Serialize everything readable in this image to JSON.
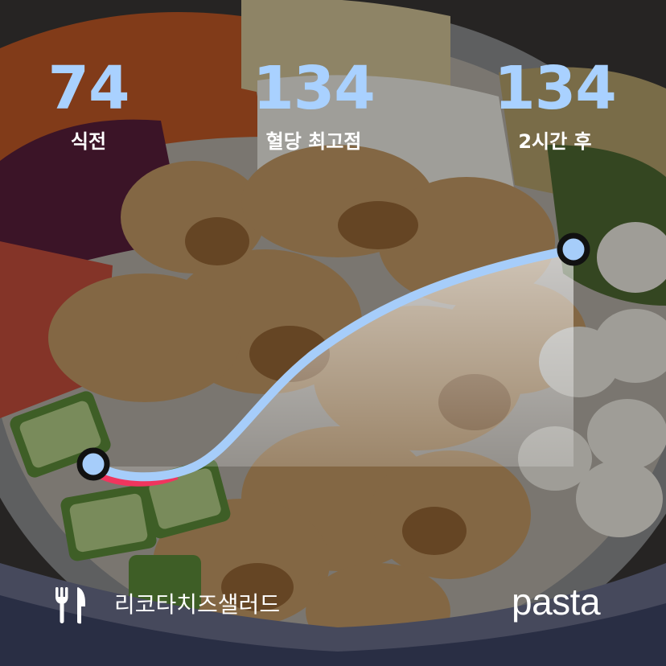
{
  "stats": [
    {
      "value": "74",
      "label": "식전"
    },
    {
      "value": "134",
      "label": "혈당 최고점"
    },
    {
      "value": "134",
      "label": "2시간 후"
    }
  ],
  "meal": {
    "icon": "utensils-icon",
    "name": "리코타치즈샐러드"
  },
  "brand": {
    "name": "pasta"
  },
  "colors": {
    "accent": "#a9d1ff",
    "curve": "#a6cdfa",
    "dip_highlight": "#f0355e",
    "text": "#ffffff"
  },
  "chart_data": {
    "type": "line",
    "series": [
      {
        "points": [
          [
            "식전",
            74
          ],
          [
            "혈당 최고점",
            134
          ],
          [
            "2시간 후",
            134
          ]
        ]
      }
    ],
    "below_baseline_highlight": true
  }
}
